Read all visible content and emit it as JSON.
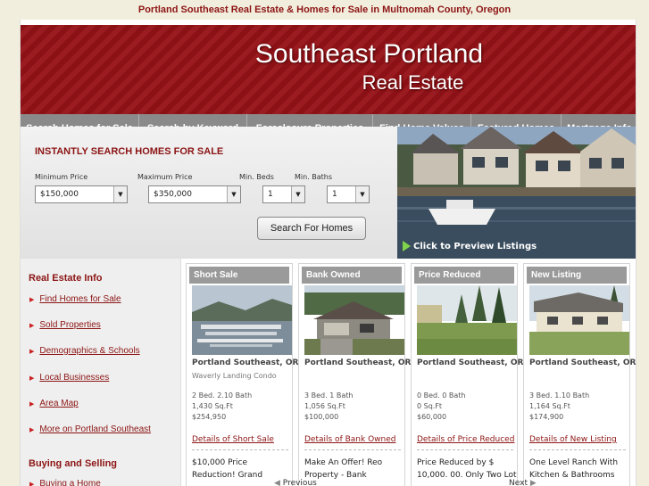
{
  "page_header": "Portland Southeast Real Estate & Homes for Sale in Multnomah County, Oregon",
  "banner": {
    "title": "Southeast Portland",
    "subtitle": "Real Estate"
  },
  "nav": [
    "Search Homes for Sale",
    "Search by Keyword",
    "Foreclosure Properties",
    "Find Home Values",
    "Featured Homes",
    "Mortgage Info"
  ],
  "search": {
    "heading": "INSTANTLY SEARCH HOMES FOR SALE",
    "min_price_label": "Minimum Price",
    "min_price_value": "$150,000",
    "max_price_label": "Maximum Price",
    "max_price_value": "$350,000",
    "min_beds_label": "Min. Beds",
    "min_beds_value": "1",
    "min_baths_label": "Min. Baths",
    "min_baths_value": "1",
    "button": "Search For Homes"
  },
  "photo": {
    "caption": "Click to Preview Listings"
  },
  "sidebar": {
    "section1_title": "Real Estate Info",
    "links": [
      "Find Homes for Sale",
      "Sold Properties",
      "Demographics & Schools",
      "Local Businesses",
      "Area Map",
      "More on Portland Southeast"
    ],
    "section2_title": "Buying and Selling",
    "section2_links": [
      "Buying a Home"
    ]
  },
  "listings": [
    {
      "badge": "Short Sale",
      "city": "Portland Southeast, OR",
      "sub": "Waverly Landing Condo",
      "beds": "2 Bed. 2.10 Bath",
      "sqft": "1,430 Sq.Ft",
      "price": "$254,950",
      "detail": "Details of Short Sale",
      "desc": "$10,000 Price Reduction! Grand"
    },
    {
      "badge": "Bank Owned",
      "city": "Portland Southeast, OR",
      "sub": "",
      "beds": "3 Bed. 1 Bath",
      "sqft": "1,056 Sq.Ft",
      "price": "$100,000",
      "detail": "Details of Bank Owned",
      "desc": "Make An Offer! Reo Property - Bank"
    },
    {
      "badge": "Price Reduced",
      "city": "Portland Southeast, OR",
      "sub": "",
      "beds": "0 Bed. 0 Bath",
      "sqft": "0 Sq.Ft",
      "price": "$60,000",
      "detail": "Details of Price Reduced",
      "desc": "Price Reduced by $ 10,000. 00. Only Two Lot"
    },
    {
      "badge": "New Listing",
      "city": "Portland Southeast, OR",
      "sub": "",
      "beds": "3 Bed. 1.10 Bath",
      "sqft": "1,164 Sq.Ft",
      "price": "$174,900",
      "detail": "Details of New Listing",
      "desc": "One Level Ranch With Kitchen & Bathrooms"
    }
  ],
  "pager": {
    "previous": "Previous",
    "next": "Next"
  }
}
